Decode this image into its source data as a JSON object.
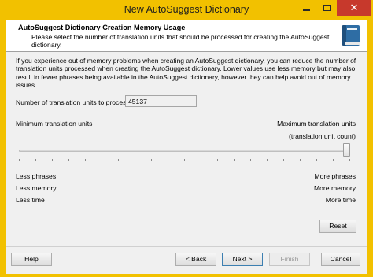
{
  "window": {
    "title": "New AutoSuggest Dictionary",
    "accent_color": "#f2c100",
    "close_color": "#c7392c"
  },
  "header": {
    "title": "AutoSuggest Dictionary Creation Memory Usage",
    "description": "Please select the number of translation units that should be processed for creating the AutoSuggest dictionary.",
    "icon": "book-icon"
  },
  "content": {
    "intro": "If you experience out of memory problems when creating an AutoSuggest dictionary, you can reduce the number of translation units processed when creating the AutoSuggest dictionary. Lower values use less memory but may also result in fewer phrases being available in the AutoSuggest dictionary, however they can help avoid out of memory issues.",
    "count_label": "Number of translation units to process:",
    "count_value": "45137",
    "min_label": "Minimum translation units",
    "max_label": "Maximum translation units",
    "unit_count_label": "(translation unit count)",
    "slider_level": 1.0,
    "left_labels": [
      "Less phrases",
      "Less memory",
      "Less time"
    ],
    "right_labels": [
      "More phrases",
      "More memory",
      "More time"
    ],
    "reset_label": "Reset"
  },
  "footer": {
    "help_label": "Help",
    "back_label": "< Back",
    "next_label": "Next >",
    "finish_label": "Finish",
    "cancel_label": "Cancel"
  }
}
